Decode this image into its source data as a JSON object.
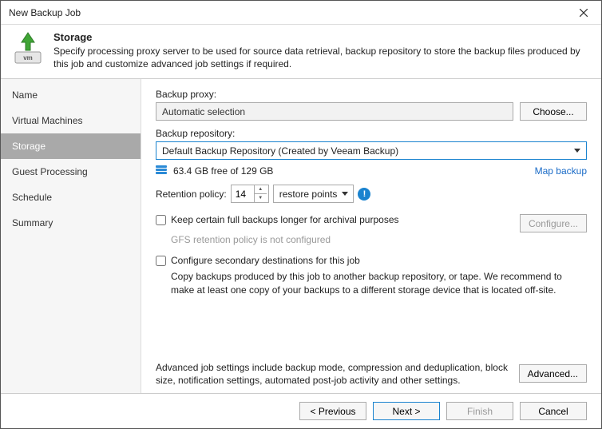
{
  "window": {
    "title": "New Backup Job"
  },
  "header": {
    "title": "Storage",
    "desc": "Specify processing proxy server to be used for source data retrieval, backup repository to store the backup files produced by this job and customize advanced job settings if required."
  },
  "sidebar": {
    "items": [
      {
        "label": "Name"
      },
      {
        "label": "Virtual Machines"
      },
      {
        "label": "Storage"
      },
      {
        "label": "Guest Processing"
      },
      {
        "label": "Schedule"
      },
      {
        "label": "Summary"
      }
    ]
  },
  "main": {
    "proxy_label": "Backup proxy:",
    "proxy_value": "Automatic selection",
    "choose_btn": "Choose...",
    "repo_label": "Backup repository:",
    "repo_value": "Default Backup Repository (Created by Veeam Backup)",
    "repo_free": "63.4 GB free of 129 GB",
    "map_backup": "Map backup",
    "retention_label": "Retention policy:",
    "retention_value": "14",
    "retention_unit": "restore points",
    "keep_full": "Keep certain full backups longer for archival purposes",
    "configure_btn": "Configure...",
    "gfs_note": "GFS retention policy is not configured",
    "secondary": "Configure secondary destinations for this job",
    "secondary_desc": "Copy backups produced by this job to another backup repository, or tape. We recommend to make at least one copy of your backups to a different storage device that is located off-site.",
    "adv_desc": "Advanced job settings include backup mode, compression and deduplication, block size, notification settings, automated post-job activity and other settings.",
    "advanced_btn": "Advanced..."
  },
  "footer": {
    "previous": "< Previous",
    "next": "Next >",
    "finish": "Finish",
    "cancel": "Cancel"
  }
}
